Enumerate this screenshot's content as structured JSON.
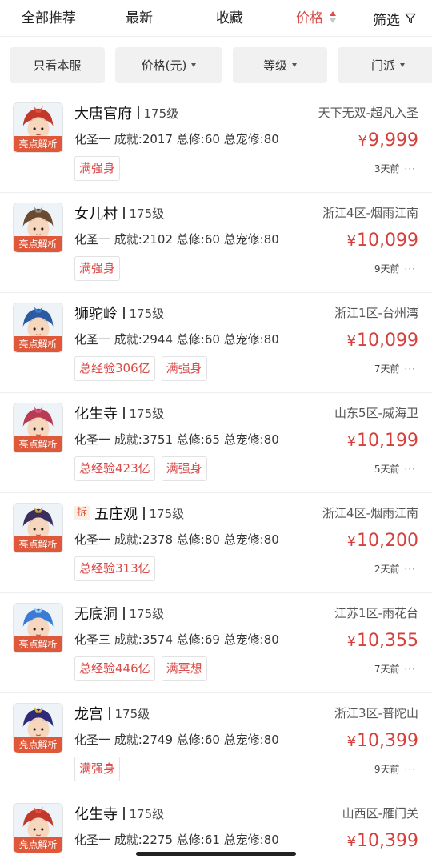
{
  "sortbar": {
    "tabs": [
      {
        "label": "全部推荐",
        "active": false
      },
      {
        "label": "最新",
        "active": false
      },
      {
        "label": "收藏",
        "active": false
      },
      {
        "label": "价格",
        "active": true
      }
    ],
    "filter_label": "筛选",
    "accent_color": "#d94b48"
  },
  "chips": [
    {
      "label": "只看本服",
      "has_caret": false
    },
    {
      "label": "价格(元)",
      "has_caret": true
    },
    {
      "label": "等级",
      "has_caret": true
    },
    {
      "label": "门派",
      "has_caret": true
    }
  ],
  "listings": [
    {
      "sect": "大唐官府",
      "level": "175级",
      "split": "",
      "stats": "化圣一 成就:2017 总修:60 总宠修:80",
      "tags": [
        "满强身"
      ],
      "server": "天下无双-超凡入圣",
      "price": "9,999",
      "currency": "¥",
      "time": "3天前",
      "avatar_tag": "亮点解析",
      "avatar_hair": "#c0392b",
      "avatar_accent": "#e74c3c"
    },
    {
      "sect": "女儿村",
      "level": "175级",
      "split": "",
      "stats": "化圣一 成就:2102 总修:60 总宠修:80",
      "tags": [
        "满强身"
      ],
      "server": "浙江4区-烟雨江南",
      "price": "10,099",
      "currency": "¥",
      "time": "9天前",
      "avatar_tag": "亮点解析",
      "avatar_hair": "#6b4a2f",
      "avatar_accent": "#8e8e8e"
    },
    {
      "sect": "狮驼岭",
      "level": "175级",
      "split": "",
      "stats": "化圣一 成就:2944 总修:60 总宠修:80",
      "tags": [
        "总经验306亿",
        "满强身"
      ],
      "server": "浙江1区-台州湾",
      "price": "10,099",
      "currency": "¥",
      "time": "7天前",
      "avatar_tag": "亮点解析",
      "avatar_hair": "#2c5aa0",
      "avatar_accent": "#3d7bd9"
    },
    {
      "sect": "化生寺",
      "level": "175级",
      "split": "",
      "stats": "化圣一 成就:3751 总修:65 总宠修:80",
      "tags": [
        "总经验423亿",
        "满强身"
      ],
      "server": "山东5区-威海卫",
      "price": "10,199",
      "currency": "¥",
      "time": "5天前",
      "avatar_tag": "亮点解析",
      "avatar_hair": "#b83b52",
      "avatar_accent": "#d9538a"
    },
    {
      "sect": "五庄观",
      "level": "175级",
      "split": "拆",
      "stats": "化圣一 成就:2378 总修:80 总宠修:80",
      "tags": [
        "总经验313亿"
      ],
      "server": "浙江4区-烟雨江南",
      "price": "10,200",
      "currency": "¥",
      "time": "2天前",
      "avatar_tag": "亮点解析",
      "avatar_hair": "#3a2f5c",
      "avatar_accent": "#d4a437"
    },
    {
      "sect": "无底洞",
      "level": "175级",
      "split": "",
      "stats": "化圣三 成就:3574 总修:69 总宠修:80",
      "tags": [
        "总经验446亿",
        "满冥想"
      ],
      "server": "江苏1区-雨花台",
      "price": "10,355",
      "currency": "¥",
      "time": "7天前",
      "avatar_tag": "亮点解析",
      "avatar_hair": "#3a7bd5",
      "avatar_accent": "#9fd3f2"
    },
    {
      "sect": "龙宫",
      "level": "175级",
      "split": "",
      "stats": "化圣一 成就:2749 总修:60 总宠修:80",
      "tags": [
        "满强身"
      ],
      "server": "浙江3区-普陀山",
      "price": "10,399",
      "currency": "¥",
      "time": "9天前",
      "avatar_tag": "亮点解析",
      "avatar_hair": "#2d2a7a",
      "avatar_accent": "#e6b422"
    },
    {
      "sect": "化生寺",
      "level": "175级",
      "split": "",
      "stats": "化圣一 成就:2275 总修:61 总宠修:80",
      "tags": [],
      "server": "山西区-雁门关",
      "price": "10,399",
      "currency": "¥",
      "time": "",
      "avatar_tag": "亮点解析",
      "avatar_hair": "#c0392b",
      "avatar_accent": "#e74c3c"
    }
  ]
}
